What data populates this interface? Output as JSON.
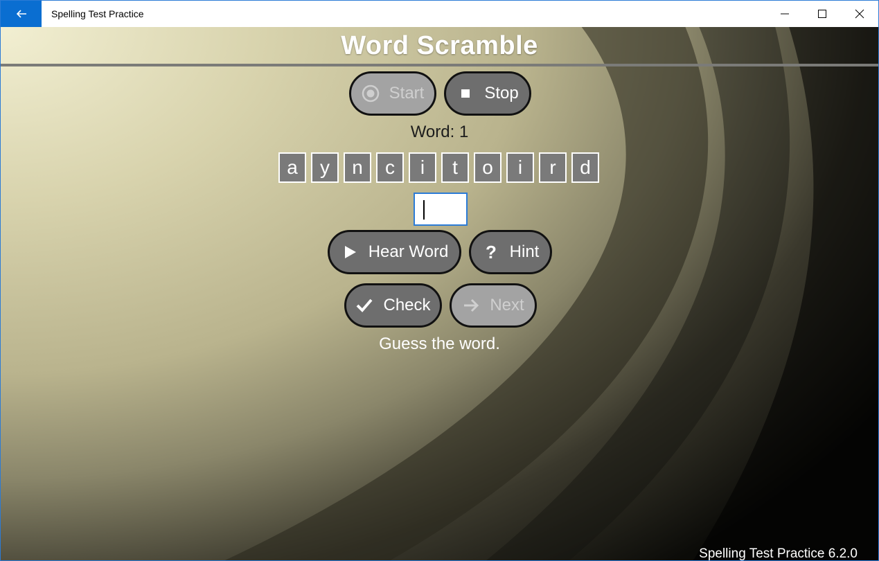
{
  "window": {
    "title": "Spelling Test Practice",
    "accent": "#0a6ed1"
  },
  "header": {
    "title": "Word Scramble"
  },
  "controls": {
    "start_label": "Start",
    "stop_label": "Stop",
    "hear_word_label": "Hear Word",
    "hint_label": "Hint",
    "check_label": "Check",
    "next_label": "Next"
  },
  "word": {
    "label": "Word:  1"
  },
  "letters": [
    "a",
    "y",
    "n",
    "c",
    "i",
    "t",
    "o",
    "i",
    "r",
    "d"
  ],
  "answer": {
    "value": ""
  },
  "status": {
    "message": "Guess the word."
  },
  "footer": {
    "version": "Spelling Test Practice 6.2.0"
  },
  "icons": {
    "back": "arrow-left-icon",
    "start": "record-icon",
    "stop": "stop-icon",
    "hear": "play-icon",
    "hint": "question-icon",
    "check": "checkmark-icon",
    "next": "arrow-right-icon"
  }
}
